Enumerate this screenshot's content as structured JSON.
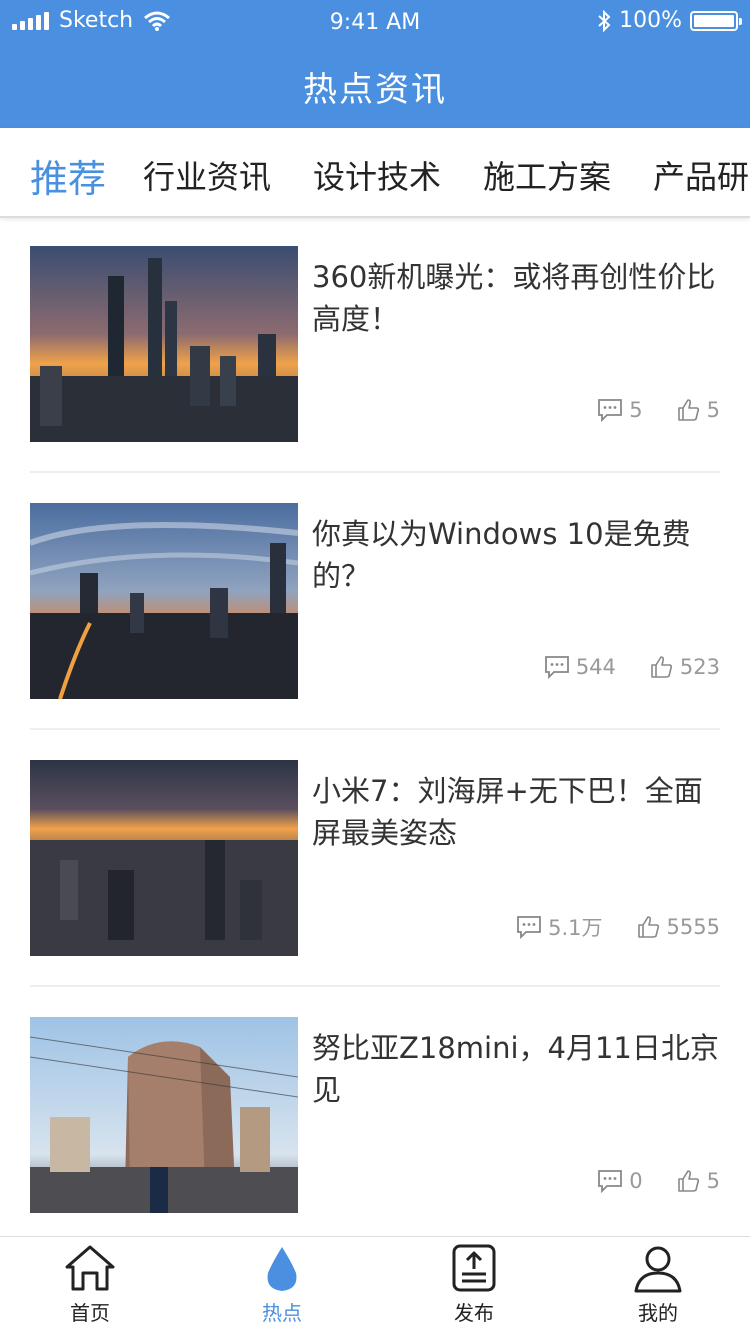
{
  "status_bar": {
    "carrier": "Sketch",
    "time": "9:41 AM",
    "battery": "100%"
  },
  "header": {
    "title": "热点资讯"
  },
  "tabs": [
    {
      "label": "推荐",
      "active": true
    },
    {
      "label": "行业资讯"
    },
    {
      "label": "设计技术"
    },
    {
      "label": "施工方案"
    },
    {
      "label": "产品研"
    }
  ],
  "articles": [
    {
      "title": "360新机曝光：或将再创性价比高度！",
      "comments": "5",
      "likes": "5"
    },
    {
      "title": "你真以为Windows 10是免费的？",
      "comments": "544",
      "likes": "523"
    },
    {
      "title": "小米7：刘海屏+无下巴！全面屏最美姿态",
      "comments": "5.1万",
      "likes": "5555"
    },
    {
      "title": "努比亚Z18mini，4月11日北京见",
      "comments": "0",
      "likes": "5"
    }
  ],
  "bottom_nav": [
    {
      "label": "首页",
      "icon": "home-icon"
    },
    {
      "label": "热点",
      "icon": "flame-drop-icon",
      "active": true
    },
    {
      "label": "发布",
      "icon": "upload-icon"
    },
    {
      "label": "我的",
      "icon": "user-icon"
    }
  ],
  "colors": {
    "accent": "#4a8fe0",
    "text": "#333333",
    "meta": "#999999"
  }
}
